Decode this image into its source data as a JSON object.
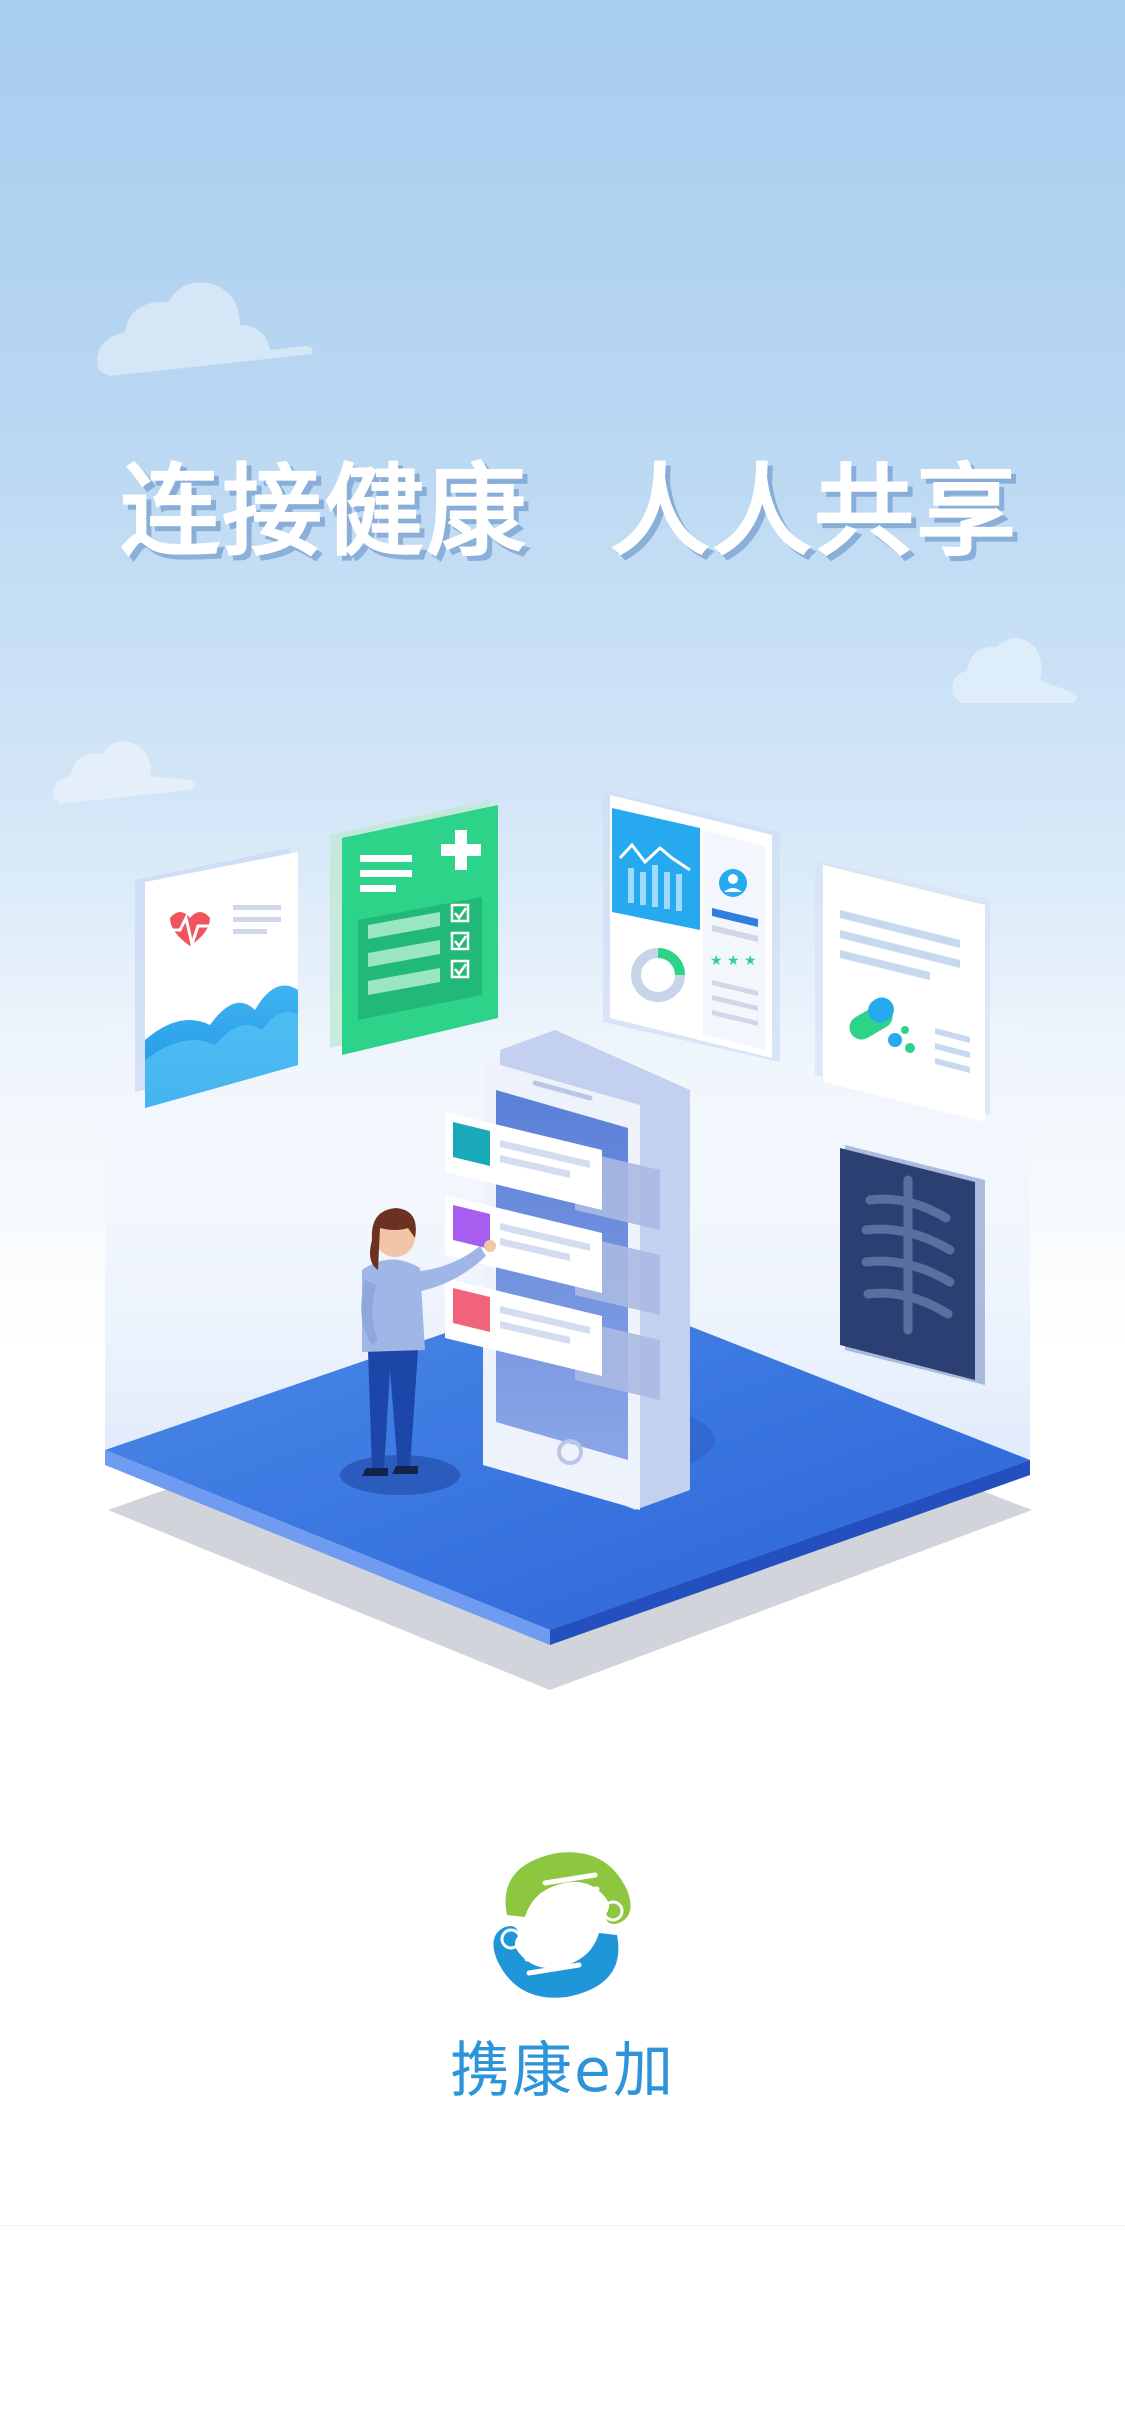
{
  "splash": {
    "slogan_left": "连接健康",
    "slogan_right": "人人共享"
  },
  "brand": {
    "name": "携康e加",
    "colors": {
      "primary_blue": "#2e94d9",
      "logo_green": "#8dc63f",
      "platform_blue": "#3a73e0",
      "card_green": "#2ed38a"
    }
  },
  "illustration": {
    "icons": [
      "heart-rate-card-icon",
      "medical-checklist-card-icon",
      "dashboard-card-icon",
      "medicine-report-card-icon",
      "xray-card-icon",
      "smartphone-icon",
      "person-icon"
    ]
  }
}
